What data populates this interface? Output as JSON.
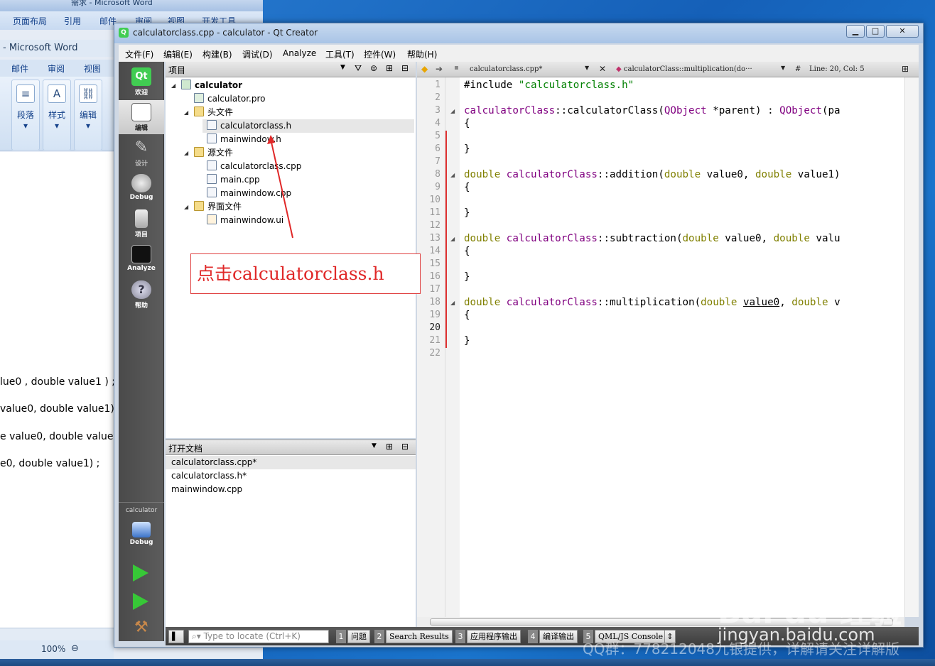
{
  "word": {
    "title": "需求 - Microsoft Word",
    "tabs_top": [
      "页面布局",
      "引用",
      "邮件",
      "审阅",
      "视图",
      "开发工具"
    ],
    "subtitle": "- Microsoft Word",
    "tabs": [
      "邮件",
      "审阅",
      "视图"
    ],
    "ribbon_groups": [
      {
        "label": "段落",
        "icon": "paragraph-icon"
      },
      {
        "label": "样式",
        "icon": "styles-icon"
      },
      {
        "label": "编辑",
        "icon": "binoculars-icon"
      }
    ],
    "doc_lines": [
      "lue0 , double value1 ) ;",
      "value0, double value1) ;",
      "e value0, double value1)",
      "e0, double value1) ;"
    ],
    "zoom": "100%"
  },
  "qt": {
    "title": "calculatorclass.cpp - calculator - Qt Creator",
    "menu": [
      "文件(F)",
      "编辑(E)",
      "构建(B)",
      "调试(D)",
      "Analyze",
      "工具(T)",
      "控件(W)",
      "帮助(H)"
    ],
    "modes": [
      "欢迎",
      "编辑",
      "设计",
      "Debug",
      "项目",
      "Analyze",
      "帮助"
    ],
    "kit": {
      "project": "calculator",
      "config": "Debug"
    },
    "project_pane": {
      "title": "项目",
      "tree": [
        {
          "label": "calculator",
          "depth": 0,
          "bold": true,
          "expanded": true
        },
        {
          "label": "calculator.pro",
          "depth": 1
        },
        {
          "label": "头文件",
          "depth": 1,
          "expanded": true
        },
        {
          "label": "calculatorclass.h",
          "depth": 2,
          "selected": true
        },
        {
          "label": "mainwindow.h",
          "depth": 2
        },
        {
          "label": "源文件",
          "depth": 1,
          "expanded": true
        },
        {
          "label": "calculatorclass.cpp",
          "depth": 2
        },
        {
          "label": "main.cpp",
          "depth": 2
        },
        {
          "label": "mainwindow.cpp",
          "depth": 2
        },
        {
          "label": "界面文件",
          "depth": 1,
          "expanded": true
        },
        {
          "label": "mainwindow.ui",
          "depth": 2
        }
      ]
    },
    "open_docs": {
      "title": "打开文档",
      "items": [
        "calculatorclass.cpp*",
        "calculatorclass.h*",
        "mainwindow.cpp"
      ]
    },
    "editor": {
      "file_combo": "calculatorclass.cpp*",
      "symbol_combo": "calculatorClass::multiplication(do···",
      "position": "Line: 20, Col: 5",
      "code": [
        "#include \"calculatorclass.h\"",
        "",
        "calculatorClass::calculatorClass(QObject *parent) : QObject(pa",
        "{",
        "",
        "}",
        "",
        "double calculatorClass::addition(double value0, double value1)",
        "{",
        "",
        "}",
        "",
        "double calculatorClass::subtraction(double value0, double valu",
        "{",
        "",
        "}",
        "",
        "double calculatorClass::multiplication(double value0, double v",
        "{",
        "",
        "}",
        ""
      ]
    },
    "locator_placeholder": "Type to locate (Ctrl+K)",
    "output_panes": [
      {
        "num": "1",
        "label": "问题"
      },
      {
        "num": "2",
        "label": "Search Results"
      },
      {
        "num": "3",
        "label": "应用程序输出"
      },
      {
        "num": "4",
        "label": "编译输出"
      },
      {
        "num": "5",
        "label": "QML/JS Console"
      }
    ]
  },
  "annotation": "点击calculatorclass.h",
  "watermark": {
    "logo": "Bai du 经验",
    "site": "jingyan.baidu.com",
    "note": "QQ群：778212048九银提供，详解请关注详解版"
  },
  "colors": {
    "keyword": "#808000",
    "type": "#800080",
    "string": "#008000",
    "annotation": "#e02828"
  }
}
